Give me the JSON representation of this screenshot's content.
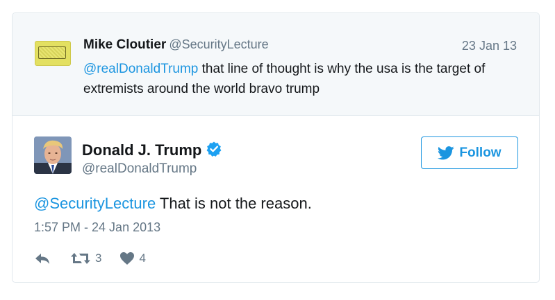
{
  "parent_tweet": {
    "name": "Mike Cloutier",
    "handle": "@SecurityLecture",
    "date": "23 Jan 13",
    "mention": "@realDonaldTrump",
    "text": " that line of thought is why the usa is the target of extremists around the world bravo trump",
    "avatar_icon": "security-logo-icon",
    "avatar_color": "#e3e061"
  },
  "tweet": {
    "name": "Donald J. Trump",
    "handle": "@realDonaldTrump",
    "verified_icon": "verified-badge-icon",
    "mention": "@SecurityLecture",
    "text": " That is not the reason.",
    "timestamp": "1:57 PM - 24 Jan 2013",
    "avatar_icon": "profile-photo"
  },
  "follow_button": {
    "label": "Follow",
    "icon": "twitter-bird-icon"
  },
  "actions": {
    "reply_icon": "reply-icon",
    "retweet_icon": "retweet-icon",
    "retweet_count": "3",
    "like_icon": "heart-icon",
    "like_count": "4"
  },
  "colors": {
    "link": "#1b95e0",
    "muted": "#657786",
    "text": "#14171a",
    "parent_bg": "#f5f8fa",
    "border": "#e1e8ed"
  }
}
